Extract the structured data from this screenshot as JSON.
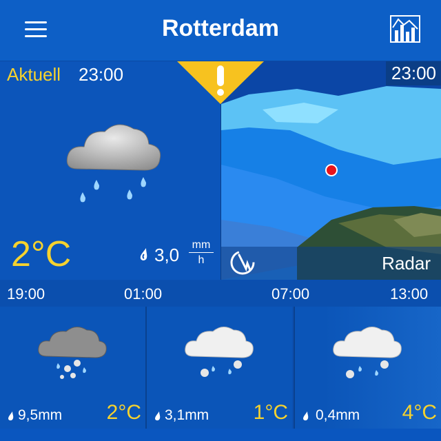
{
  "header": {
    "title": "Rotterdam"
  },
  "current": {
    "label": "Aktuell",
    "time": "23:00",
    "temp": "2°C",
    "precip_value": "3,0",
    "unit_num": "mm",
    "unit_den": "h"
  },
  "radar": {
    "time": "23:00",
    "label": "Radar"
  },
  "timeline": [
    "19:00",
    "01:00",
    "07:00",
    "13:00"
  ],
  "forecast": [
    {
      "precip": "9,5mm",
      "temp": "2°C"
    },
    {
      "precip": "3,1mm",
      "temp": "1°C"
    },
    {
      "precip": "0,4mm",
      "temp": "4°C"
    }
  ],
  "colors": {
    "accent": "#f6d22e",
    "warning": "#f7c21f",
    "header": "#0d5fc6"
  },
  "icons": [
    "menu-icon",
    "chart-icon",
    "warning-icon",
    "rain-cloud-icon",
    "radar-play-icon",
    "drop-icon",
    "sleet-cloud-icon"
  ]
}
